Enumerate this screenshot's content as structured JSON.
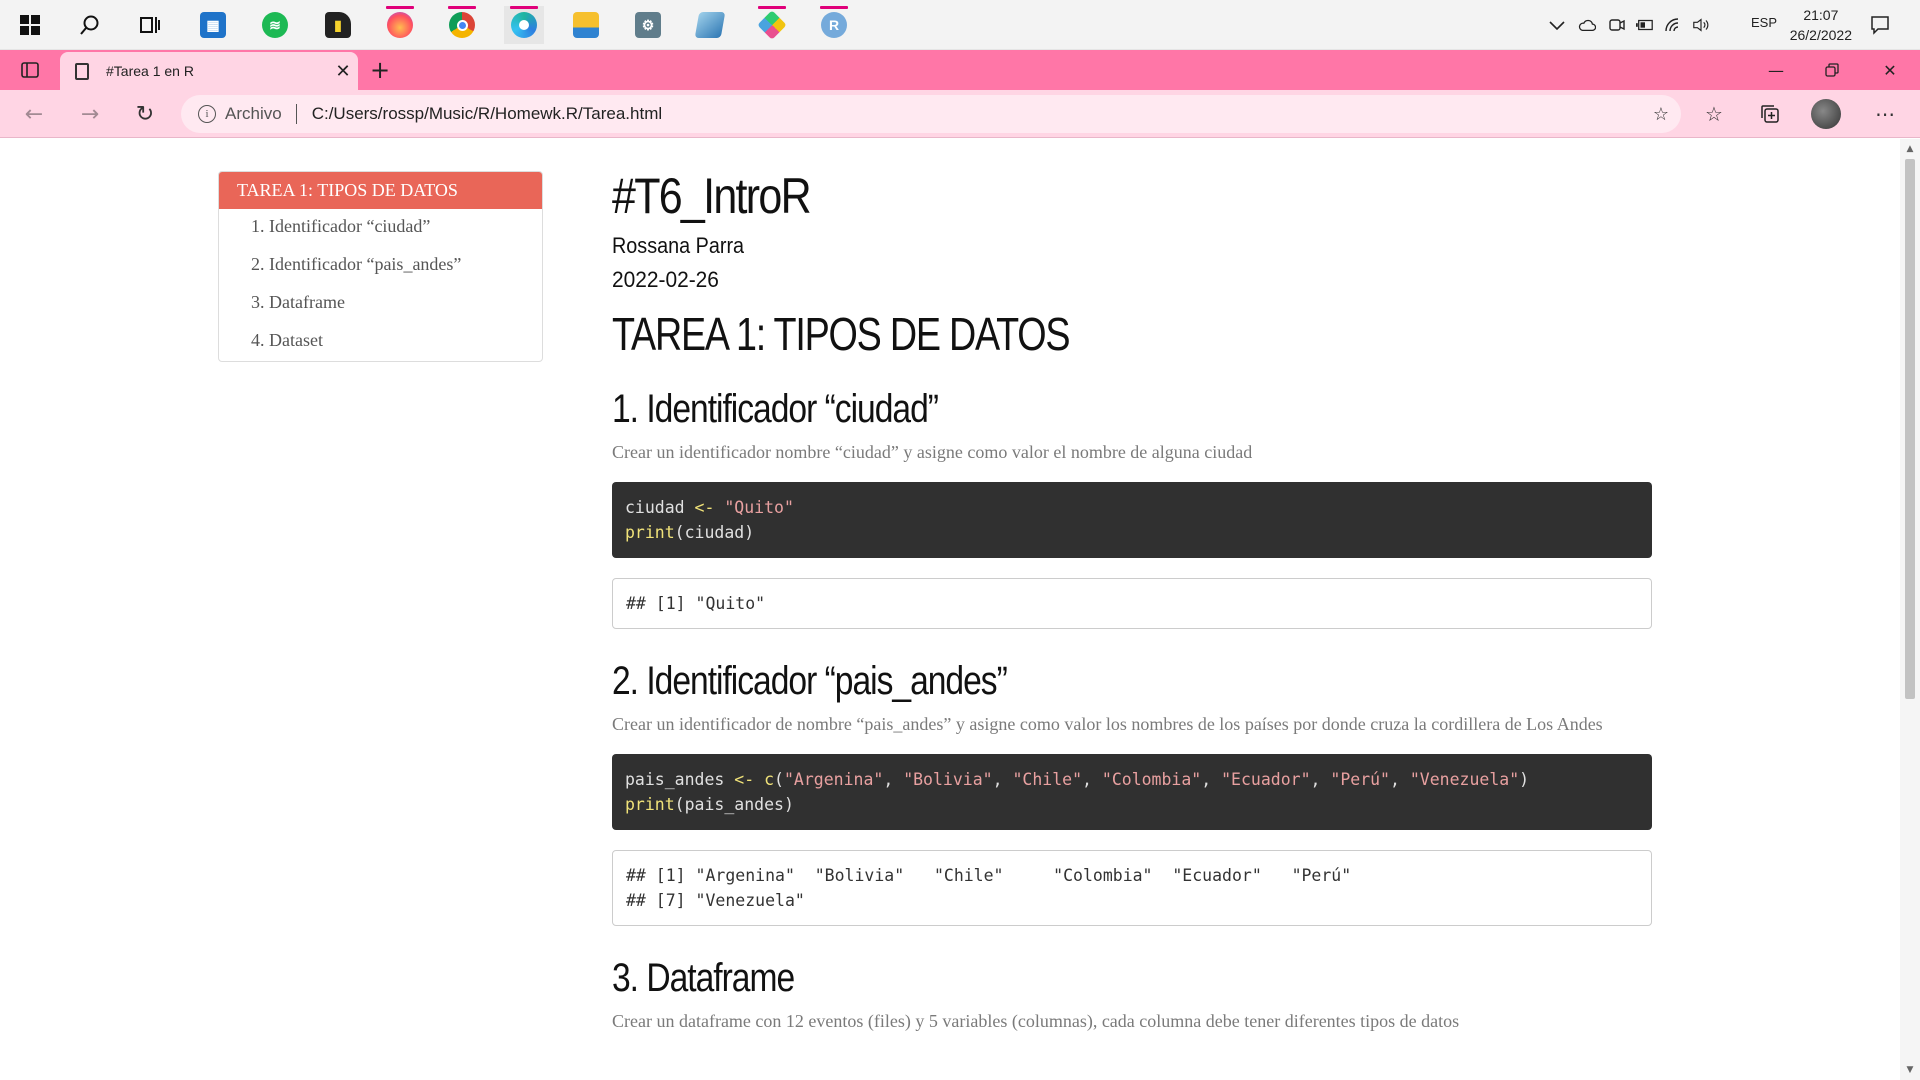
{
  "taskbar": {
    "apps": [
      {
        "name": "start",
        "glyph": "⊞",
        "color": "#1a1a1a"
      },
      {
        "name": "search",
        "glyph": "⌕",
        "color": "#1a1a1a"
      },
      {
        "name": "task-view",
        "glyph": "▣",
        "color": "#1a1a1a"
      },
      {
        "name": "calendar",
        "glyph": "▦",
        "color": "#1f73c9"
      },
      {
        "name": "spotify",
        "glyph": "≋",
        "color": "#1db954"
      },
      {
        "name": "sticky-notes",
        "glyph": "▮",
        "color": "#222222"
      },
      {
        "name": "firefox",
        "glyph": "◉",
        "color": "#ff7139"
      },
      {
        "name": "chrome",
        "glyph": "◎",
        "color": "#db4437"
      },
      {
        "name": "edge",
        "glyph": "e",
        "color": "#1b84d8"
      },
      {
        "name": "file-explorer",
        "glyph": "▬",
        "color": "#f6c02e"
      },
      {
        "name": "app-settings",
        "glyph": "⚙",
        "color": "#607d8b"
      },
      {
        "name": "app-blue",
        "glyph": "◆",
        "color": "#4a90c0"
      },
      {
        "name": "app-diamond",
        "glyph": "◈",
        "color": "#e94f8f"
      },
      {
        "name": "rstudio",
        "glyph": "R",
        "color": "#75aadb"
      }
    ],
    "language": "ESP",
    "time": "21:07",
    "date": "26/2/2022"
  },
  "browser": {
    "tab_title": "#Tarea 1 en R",
    "archivo_label": "Archivo",
    "url": "C:/Users/rossp/Music/R/Homewk.R/Tarea.html"
  },
  "toc": {
    "header": "TAREA 1: TIPOS DE DATOS",
    "items": [
      "1. Identificador “ciudad”",
      "2. Identificador “pais_andes”",
      "3. Dataframe",
      "4. Dataset"
    ]
  },
  "doc": {
    "title": "#T6_IntroR",
    "author": "Rossana Parra",
    "date": "2022-02-26",
    "h1": "TAREA 1: TIPOS DE DATOS",
    "sections": [
      {
        "heading": "1. Identificador “ciudad”",
        "text": "Crear un identificador nombre “ciudad” y asigne como valor el nombre de alguna ciudad",
        "output": "## [1] \"Quito\""
      },
      {
        "heading": "2. Identificador “pais_andes”",
        "text": "Crear un identificador de nombre “pais_andes” y asigne como valor los nombres de los países por donde cruza la cordillera de Los Andes",
        "output": "## [1] \"Argenina\"  \"Bolivia\"   \"Chile\"     \"Colombia\"  \"Ecuador\"   \"Perú\"     \n## [7] \"Venezuela\""
      },
      {
        "heading": "3. Dataframe",
        "text": "Crear un dataframe con 12 eventos (files) y 5 variables (columnas), cada columna debe tener diferentes tipos de datos"
      }
    ],
    "code1": {
      "l1_var": "ciudad",
      "l1_op": "<-",
      "l1_str": "\"Quito\"",
      "l2_fn": "print",
      "l2_arg": "(ciudad)"
    },
    "code2": {
      "l1_var": "pais_andes",
      "l1_op": "<-",
      "l1_fn": "c",
      "strings": [
        "\"Argenina\"",
        "\"Bolivia\"",
        "\"Chile\"",
        "\"Colombia\"",
        "\"Ecuador\"",
        "\"Perú\"",
        "\"Venezuela\""
      ],
      "l2_fn": "print",
      "l2_arg": "(pais_andes)"
    }
  }
}
